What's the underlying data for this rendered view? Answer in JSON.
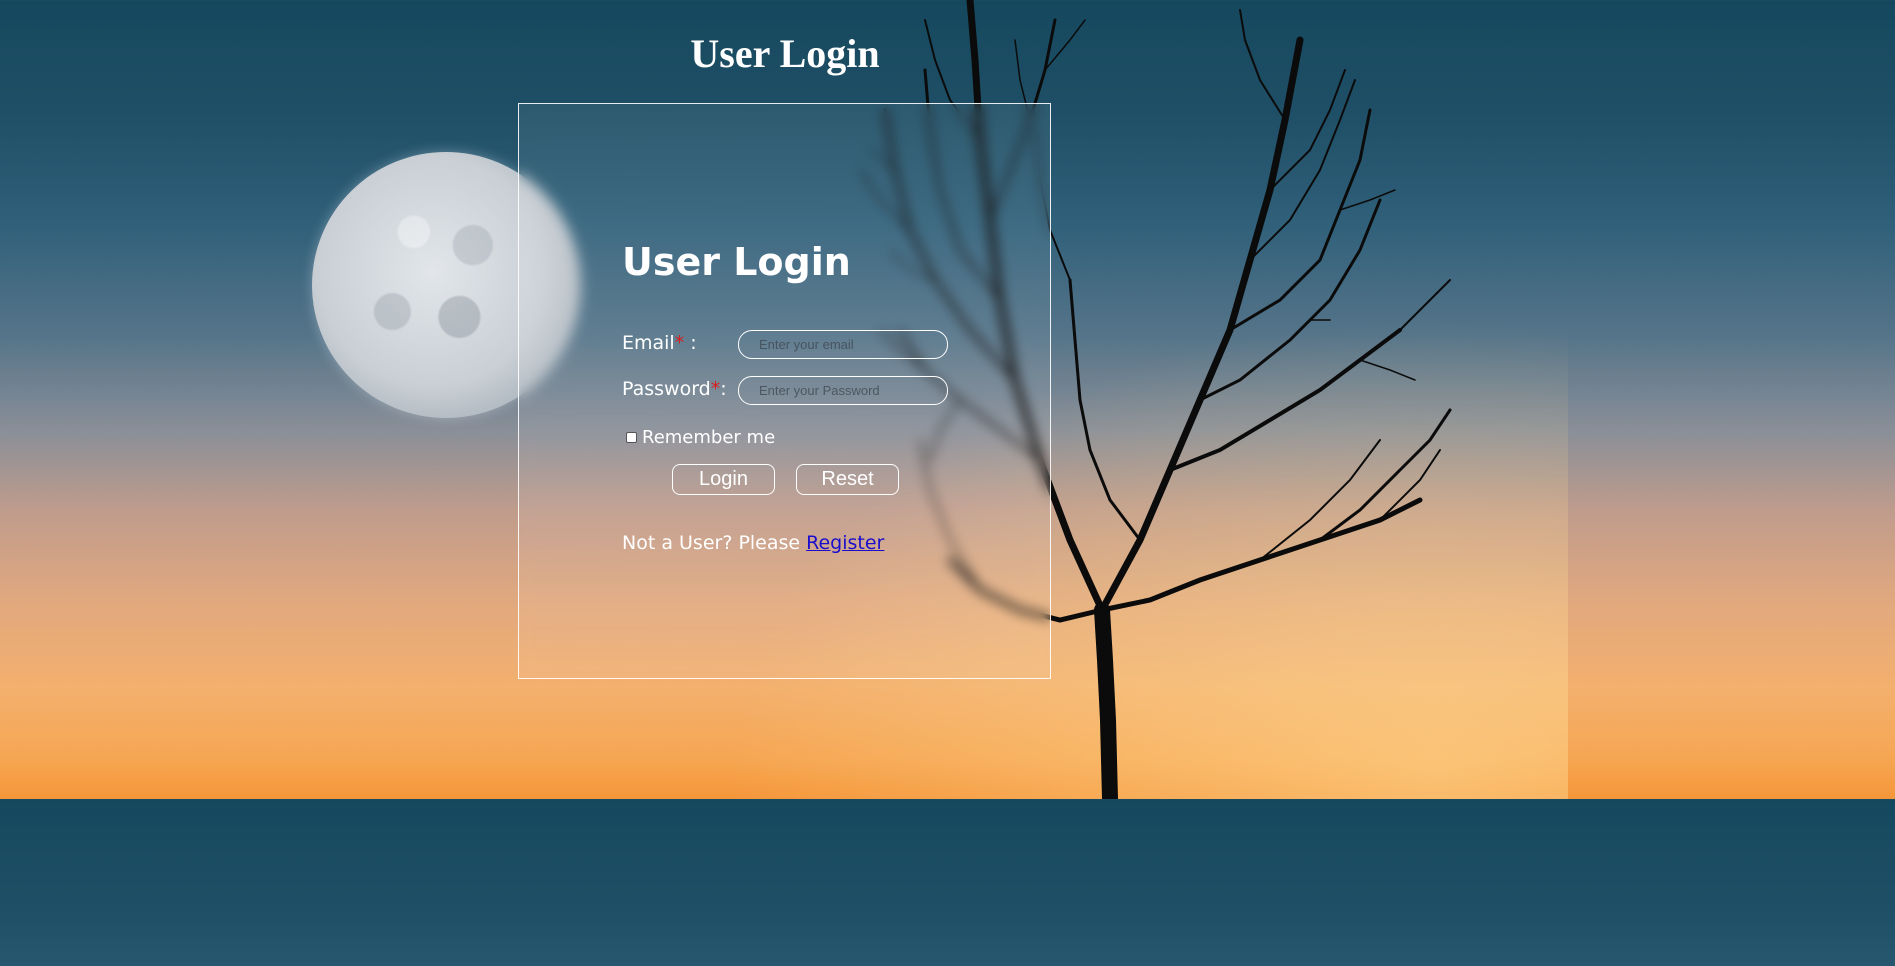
{
  "page": {
    "header_title": "User Login"
  },
  "login_form": {
    "title": "User Login",
    "email": {
      "label": "Email",
      "required_mark": "*",
      "separator": " :",
      "placeholder": "Enter your email",
      "value": ""
    },
    "password": {
      "label": "Password",
      "required_mark": "*",
      "separator": ":",
      "placeholder": "Enter your Password",
      "value": ""
    },
    "remember": {
      "label": "Remember me",
      "checked": false
    },
    "login_button": "Login",
    "reset_button": "Reset",
    "register_prompt": "Not a User? Please ",
    "register_link": "Register"
  },
  "colors": {
    "required": "#d62020",
    "link": "#1a0dcc",
    "text": "#ffffff"
  }
}
